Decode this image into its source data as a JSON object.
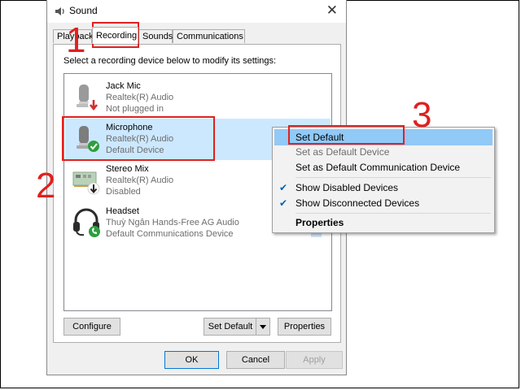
{
  "window": {
    "title": "Sound",
    "close_glyph": "✕",
    "title_icon": "speaker-icon"
  },
  "tabs": [
    {
      "label": "Playback",
      "active": false
    },
    {
      "label": "Recording",
      "active": true
    },
    {
      "label": "Sounds",
      "active": false
    },
    {
      "label": "Communications",
      "active": false
    }
  ],
  "instruction": "Select a recording device below to modify its settings:",
  "devices": [
    {
      "name": "Jack Mic",
      "driver": "Realtek(R) Audio",
      "status": "Not plugged in",
      "icon": "microphone-icon",
      "badge": "red-down-arrow",
      "selected": false
    },
    {
      "name": "Microphone",
      "driver": "Realtek(R) Audio",
      "status": "Default Device",
      "icon": "microphone-icon",
      "badge": "green-check",
      "selected": true
    },
    {
      "name": "Stereo Mix",
      "driver": "Realtek(R) Audio",
      "status": "Disabled",
      "icon": "sound-card-icon",
      "badge": "black-down-arrow",
      "selected": false
    },
    {
      "name": "Headset",
      "driver": "Thuỳ Ngân Hands-Free AG Audio",
      "status": "Default Communications Device",
      "icon": "headset-icon",
      "badge": "green-phone",
      "selected": false
    }
  ],
  "buttons": {
    "configure": "Configure",
    "set_default": "Set Default",
    "properties": "Properties",
    "ok": "OK",
    "cancel": "Cancel",
    "apply": "Apply"
  },
  "context_menu": {
    "items": [
      {
        "label": "Set Default",
        "state": "highlighted"
      },
      {
        "label": "Set as Default Device",
        "state": "disabled"
      },
      {
        "label": "Set as Default Communication Device",
        "state": "normal"
      },
      {
        "label": "Show Disabled Devices",
        "state": "checked"
      },
      {
        "label": "Show Disconnected Devices",
        "state": "checked"
      },
      {
        "label": "Properties",
        "state": "bold"
      }
    ],
    "check_glyph": "✔"
  },
  "annotations": {
    "step1": "1",
    "step2": "2",
    "step3": "3",
    "color": "#e0201f"
  },
  "colors": {
    "selection": "#cce8ff",
    "menu_highlight": "#91c9f7",
    "accent": "#0078d7"
  }
}
